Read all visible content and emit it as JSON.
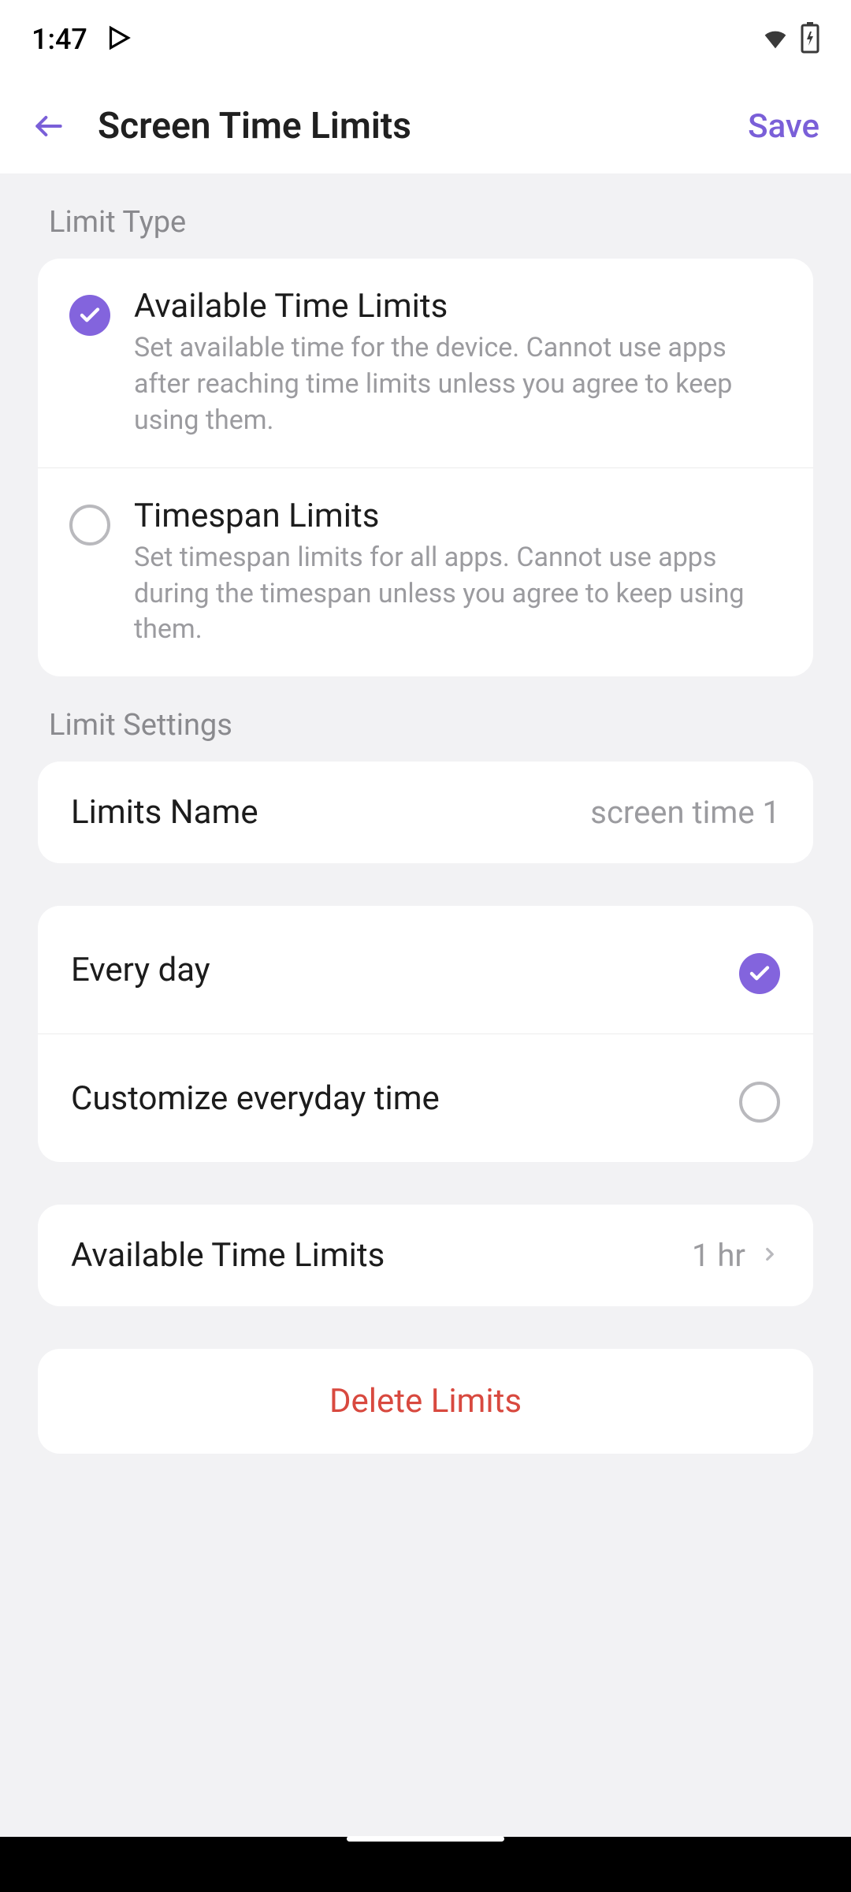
{
  "status": {
    "time": "1:47"
  },
  "header": {
    "title": "Screen Time Limits",
    "save": "Save"
  },
  "sections": {
    "limitType": "Limit Type",
    "limitSettings": "Limit Settings"
  },
  "limitOptions": {
    "available": {
      "title": "Available Time Limits",
      "desc": "Set available time for the device. Cannot use apps after reaching time limits unless you agree to keep using them."
    },
    "timespan": {
      "title": "Timespan Limits",
      "desc": "Set timespan limits for all apps. Cannot use apps during the timespan unless you agree to keep using them."
    }
  },
  "limitsName": {
    "label": "Limits Name",
    "value": "screen time 1"
  },
  "schedule": {
    "everyday": "Every day",
    "customize": "Customize everyday time"
  },
  "timeLimit": {
    "label": "Available Time Limits",
    "value": "1 hr"
  },
  "delete": "Delete Limits",
  "colors": {
    "accent": "#8364dd",
    "danger": "#d8493f"
  }
}
